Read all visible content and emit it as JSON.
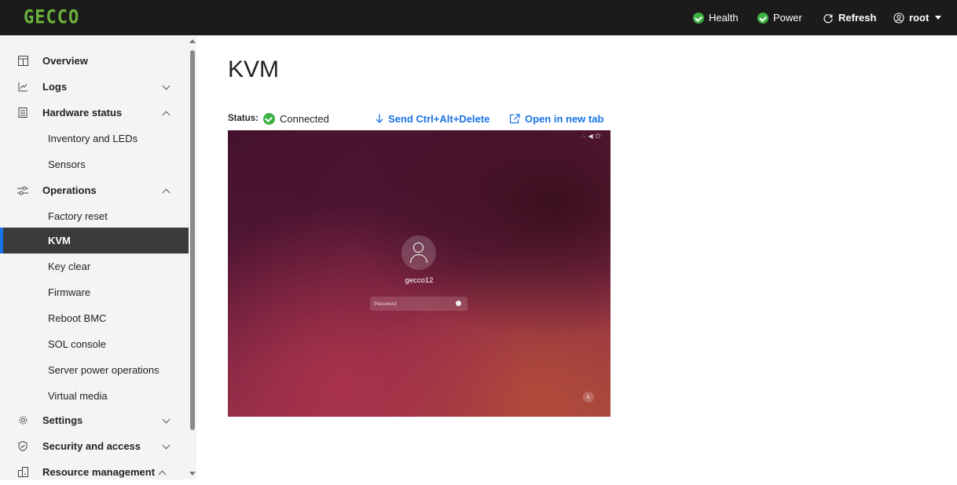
{
  "header": {
    "logo": "GECCO",
    "health_label": "Health",
    "power_label": "Power",
    "refresh_label": "Refresh",
    "user_label": "root"
  },
  "sidebar": {
    "items": [
      {
        "label": "Overview",
        "icon": "overview-icon"
      },
      {
        "label": "Logs",
        "icon": "logs-icon",
        "chevron": "down"
      },
      {
        "label": "Hardware status",
        "icon": "hardware-icon",
        "chevron": "up"
      },
      {
        "label": "Inventory and LEDs"
      },
      {
        "label": "Sensors"
      },
      {
        "label": "Operations",
        "icon": "operations-icon",
        "chevron": "up"
      },
      {
        "label": "Factory reset"
      },
      {
        "label": "KVM",
        "active": true
      },
      {
        "label": "Key clear"
      },
      {
        "label": "Firmware"
      },
      {
        "label": "Reboot BMC"
      },
      {
        "label": "SOL console"
      },
      {
        "label": "Server power operations"
      },
      {
        "label": "Virtual media"
      },
      {
        "label": "Settings",
        "icon": "settings-icon",
        "chevron": "down"
      },
      {
        "label": "Security and access",
        "icon": "shield-icon",
        "chevron": "down"
      },
      {
        "label": "Resource management",
        "icon": "resource-icon",
        "chevron": "up"
      }
    ]
  },
  "main": {
    "title": "KVM",
    "status_label": "Status:",
    "status_value": "Connected",
    "send_cad_label": "Send Ctrl+Alt+Delete",
    "open_tab_label": "Open in new tab"
  },
  "kvm_screen": {
    "username": "gecco12",
    "password_placeholder": "Password"
  },
  "colors": {
    "topbar": "#1b1b1b",
    "accent": "#1a73e8",
    "ok": "#3cb043",
    "sidebar_bg": "#f4f4f4",
    "active_bg": "#3b3b3b"
  }
}
